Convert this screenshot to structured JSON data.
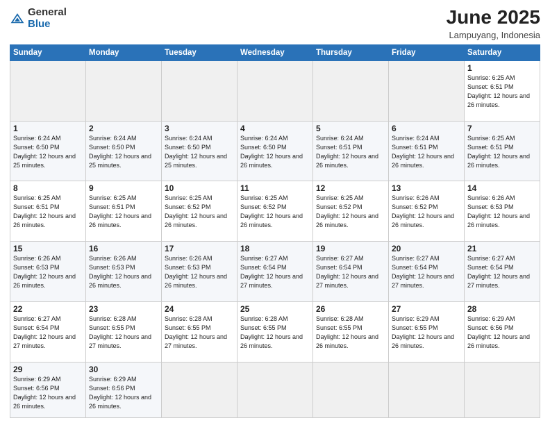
{
  "header": {
    "logo": {
      "general": "General",
      "blue": "Blue"
    },
    "title": "June 2025",
    "subtitle": "Lampuyang, Indonesia"
  },
  "calendar": {
    "days_of_week": [
      "Sunday",
      "Monday",
      "Tuesday",
      "Wednesday",
      "Thursday",
      "Friday",
      "Saturday"
    ],
    "weeks": [
      [
        {
          "day": "",
          "empty": true
        },
        {
          "day": "",
          "empty": true
        },
        {
          "day": "",
          "empty": true
        },
        {
          "day": "",
          "empty": true
        },
        {
          "day": "",
          "empty": true
        },
        {
          "day": "",
          "empty": true
        },
        {
          "day": "1",
          "sunrise": "6:25 AM",
          "sunset": "6:51 PM",
          "daylight": "12 hours and 26 minutes."
        }
      ],
      [
        {
          "day": "1",
          "sunrise": "6:24 AM",
          "sunset": "6:50 PM",
          "daylight": "12 hours and 25 minutes."
        },
        {
          "day": "2",
          "sunrise": "6:24 AM",
          "sunset": "6:50 PM",
          "daylight": "12 hours and 25 minutes."
        },
        {
          "day": "3",
          "sunrise": "6:24 AM",
          "sunset": "6:50 PM",
          "daylight": "12 hours and 25 minutes."
        },
        {
          "day": "4",
          "sunrise": "6:24 AM",
          "sunset": "6:50 PM",
          "daylight": "12 hours and 26 minutes."
        },
        {
          "day": "5",
          "sunrise": "6:24 AM",
          "sunset": "6:51 PM",
          "daylight": "12 hours and 26 minutes."
        },
        {
          "day": "6",
          "sunrise": "6:24 AM",
          "sunset": "6:51 PM",
          "daylight": "12 hours and 26 minutes."
        },
        {
          "day": "7",
          "sunrise": "6:25 AM",
          "sunset": "6:51 PM",
          "daylight": "12 hours and 26 minutes."
        }
      ],
      [
        {
          "day": "8",
          "sunrise": "6:25 AM",
          "sunset": "6:51 PM",
          "daylight": "12 hours and 26 minutes."
        },
        {
          "day": "9",
          "sunrise": "6:25 AM",
          "sunset": "6:51 PM",
          "daylight": "12 hours and 26 minutes."
        },
        {
          "day": "10",
          "sunrise": "6:25 AM",
          "sunset": "6:52 PM",
          "daylight": "12 hours and 26 minutes."
        },
        {
          "day": "11",
          "sunrise": "6:25 AM",
          "sunset": "6:52 PM",
          "daylight": "12 hours and 26 minutes."
        },
        {
          "day": "12",
          "sunrise": "6:25 AM",
          "sunset": "6:52 PM",
          "daylight": "12 hours and 26 minutes."
        },
        {
          "day": "13",
          "sunrise": "6:26 AM",
          "sunset": "6:52 PM",
          "daylight": "12 hours and 26 minutes."
        },
        {
          "day": "14",
          "sunrise": "6:26 AM",
          "sunset": "6:53 PM",
          "daylight": "12 hours and 26 minutes."
        }
      ],
      [
        {
          "day": "15",
          "sunrise": "6:26 AM",
          "sunset": "6:53 PM",
          "daylight": "12 hours and 26 minutes."
        },
        {
          "day": "16",
          "sunrise": "6:26 AM",
          "sunset": "6:53 PM",
          "daylight": "12 hours and 26 minutes."
        },
        {
          "day": "17",
          "sunrise": "6:26 AM",
          "sunset": "6:53 PM",
          "daylight": "12 hours and 26 minutes."
        },
        {
          "day": "18",
          "sunrise": "6:27 AM",
          "sunset": "6:54 PM",
          "daylight": "12 hours and 27 minutes."
        },
        {
          "day": "19",
          "sunrise": "6:27 AM",
          "sunset": "6:54 PM",
          "daylight": "12 hours and 27 minutes."
        },
        {
          "day": "20",
          "sunrise": "6:27 AM",
          "sunset": "6:54 PM",
          "daylight": "12 hours and 27 minutes."
        },
        {
          "day": "21",
          "sunrise": "6:27 AM",
          "sunset": "6:54 PM",
          "daylight": "12 hours and 27 minutes."
        }
      ],
      [
        {
          "day": "22",
          "sunrise": "6:27 AM",
          "sunset": "6:54 PM",
          "daylight": "12 hours and 27 minutes."
        },
        {
          "day": "23",
          "sunrise": "6:28 AM",
          "sunset": "6:55 PM",
          "daylight": "12 hours and 27 minutes."
        },
        {
          "day": "24",
          "sunrise": "6:28 AM",
          "sunset": "6:55 PM",
          "daylight": "12 hours and 27 minutes."
        },
        {
          "day": "25",
          "sunrise": "6:28 AM",
          "sunset": "6:55 PM",
          "daylight": "12 hours and 26 minutes."
        },
        {
          "day": "26",
          "sunrise": "6:28 AM",
          "sunset": "6:55 PM",
          "daylight": "12 hours and 26 minutes."
        },
        {
          "day": "27",
          "sunrise": "6:29 AM",
          "sunset": "6:55 PM",
          "daylight": "12 hours and 26 minutes."
        },
        {
          "day": "28",
          "sunrise": "6:29 AM",
          "sunset": "6:56 PM",
          "daylight": "12 hours and 26 minutes."
        }
      ],
      [
        {
          "day": "29",
          "sunrise": "6:29 AM",
          "sunset": "6:56 PM",
          "daylight": "12 hours and 26 minutes."
        },
        {
          "day": "30",
          "sunrise": "6:29 AM",
          "sunset": "6:56 PM",
          "daylight": "12 hours and 26 minutes."
        },
        {
          "day": "",
          "empty": true
        },
        {
          "day": "",
          "empty": true
        },
        {
          "day": "",
          "empty": true
        },
        {
          "day": "",
          "empty": true
        },
        {
          "day": "",
          "empty": true
        }
      ]
    ]
  }
}
